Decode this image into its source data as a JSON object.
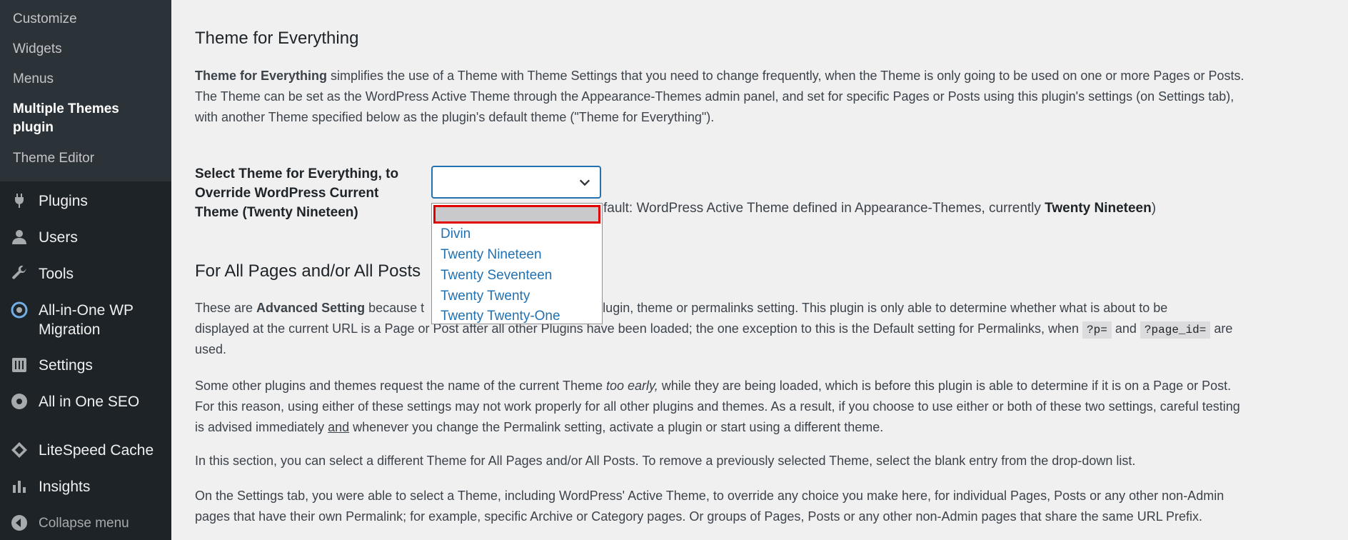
{
  "sidebar": {
    "submenu": [
      "Customize",
      "Widgets",
      "Menus",
      "Multiple Themes plugin",
      "Theme Editor"
    ],
    "items": [
      {
        "label": "Plugins",
        "icon": "plugins-icon"
      },
      {
        "label": "Users",
        "icon": "users-icon"
      },
      {
        "label": "Tools",
        "icon": "tools-icon"
      },
      {
        "label": "All-in-One WP Migration",
        "icon": "migration-icon"
      },
      {
        "label": "Settings",
        "icon": "settings-icon"
      },
      {
        "label": "All in One SEO",
        "icon": "seo-icon"
      },
      {
        "label": "LiteSpeed Cache",
        "icon": "litespeed-icon"
      },
      {
        "label": "Insights",
        "icon": "insights-icon"
      }
    ],
    "collapse_label": "Collapse menu"
  },
  "section1": {
    "title": "Theme for Everything",
    "intro_bold": "Theme for Everything",
    "intro_line1": " simplifies the use of a Theme with Theme Settings that you need to change frequently, when the Theme is only going to be used on one or more Pages or Posts.",
    "intro_line2": "The Theme can be set as the WordPress Active Theme through the Appearance-Themes admin panel, and set for specific Pages or Posts using this plugin's settings (on Settings tab),",
    "intro_line3": "with another Theme specified below as the plugin's default theme (\"Theme for Everything\").",
    "field_label": "Select Theme for Everything, to Override WordPress Current Theme (Twenty Nineteen)",
    "select_value": "",
    "options": [
      "",
      "Divin",
      "Twenty Nineteen",
      "Twenty Seventeen",
      "Twenty Twenty",
      "Twenty Twenty-One"
    ],
    "desc_text": "fault: WordPress Active Theme defined in Appearance-Themes, currently ",
    "desc_bold": "Twenty Nineteen",
    "desc_close": ")"
  },
  "section2": {
    "title": "For All Pages and/or All Posts",
    "p1_a": "These are ",
    "p1_bold": "Advanced Setting",
    "p1_b": " because t",
    "p1_c": "y other plugin, theme or permalinks setting. This plugin is only able to determine whether what is about to be",
    "p1_line2_a": "displayed at the current URL is a Page or Post after all other Plugins have been loaded; the one exception to this is the Default setting for Permalinks, when ",
    "p1_code1": "?p=",
    "p1_and": " and ",
    "p1_code2": "?page_id=",
    "p1_are": " are",
    "p1_line3": "used.",
    "p2_line1_a": "Some other plugins and themes request the name of the current Theme ",
    "p2_line1_em": "too early,",
    "p2_line1_b": " while they are being loaded, which is before this plugin is able to determine if it is on a Page or Post.",
    "p2_line2": "For this reason, using either of these settings may not work properly for all other plugins and themes. As a result, if you choose to use either or both of these two settings, careful testing",
    "p2_line3_a": "is advised immediately ",
    "p2_line3_u": "and",
    "p2_line3_b": " whenever you change the Permalink setting, activate a plugin or start using a different theme.",
    "p3": "In this section, you can select a different Theme for All Pages and/or All Posts. To remove a previously selected Theme, select the blank entry from the drop-down list.",
    "p4_line1": "On the Settings tab, you were able to select a Theme, including WordPress' Active Theme, to override any choice you make here, for individual Pages, Posts or any other non-Admin",
    "p4_line2": "pages that have their own Permalink; for example, specific Archive or Category pages. Or groups of Pages, Posts or any other non-Admin pages that share the same URL Prefix."
  }
}
